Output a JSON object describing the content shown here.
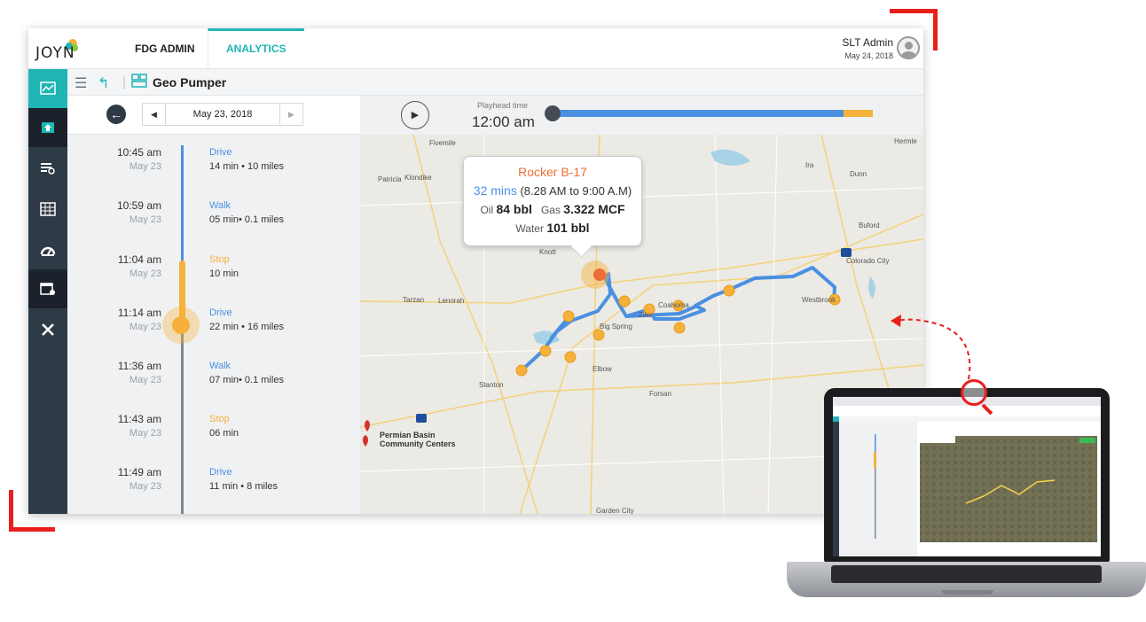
{
  "app": {
    "logo_text": "JOYN",
    "nav": {
      "admin": "FDG ADMIN",
      "analytics": "ANALYTICS"
    },
    "user": {
      "name": "SLT Admin",
      "date": "May 24, 2018"
    }
  },
  "subheader": {
    "title": "Geo Pumper"
  },
  "date_picker": {
    "value": "May 23, 2018",
    "prev": "◀",
    "next": "▶"
  },
  "timeline": [
    {
      "time": "10:45 am",
      "date": "May 23",
      "type": "Drive",
      "detail": "14 min • 10 miles",
      "color": "#4a90e2"
    },
    {
      "time": "10:59 am",
      "date": "May 23",
      "type": "Walk",
      "detail": "05 min• 0.1 miles",
      "color": "#4a90e2"
    },
    {
      "time": "11:04 am",
      "date": "May 23",
      "type": "Stop",
      "detail": "10 min",
      "color": "#f6b13a"
    },
    {
      "time": "11:14 am",
      "date": "May 23",
      "type": "Drive",
      "detail": "22 min • 16 miles",
      "color": "#4a90e2"
    },
    {
      "time": "11:36 am",
      "date": "May 23",
      "type": "Walk",
      "detail": "07 min• 0.1 miles",
      "color": "#4a90e2"
    },
    {
      "time": "11:43 am",
      "date": "May 23",
      "type": "Stop",
      "detail": "06 min",
      "color": "#f6b13a"
    },
    {
      "time": "11:49 am",
      "date": "May 23",
      "type": "Drive",
      "detail": "11 min  • 8 miles",
      "color": "#4a90e2"
    }
  ],
  "player": {
    "label": "Playhead time",
    "time": "12:00 am",
    "progress": 0.9,
    "orange_share": 0.09
  },
  "popup": {
    "title": "Rocker B-17",
    "duration": "32 mins",
    "range": "(8.28 AM to 9:00 A.M)",
    "oil_label": "Oil",
    "oil_value": "84 bbl",
    "gas_label": "Gas",
    "gas_value": "3.322 MCF",
    "water_label": "Water",
    "water_value": "101 bbl"
  },
  "map_labels": {
    "fivemile": "Fivemile",
    "hermleigh": "Hermle",
    "ira": "Ira",
    "dunn": "Dunn",
    "buford": "Buford",
    "colorado_city": "Colorado City",
    "patricia": "Patricia",
    "klondike": "Klondike",
    "knott": "Knott",
    "tarzan": "Tarzan",
    "lenorah": "Lenorah",
    "ziler": "Ziler",
    "big_spring": "Big Spring",
    "elbow": "Elbow",
    "stanton": "Stanton",
    "forsan": "Forsan",
    "garden_city": "Garden City",
    "westbrook": "Westbrook",
    "coahoma": "Coahoma",
    "poi_line1": "Permian Basin",
    "poi_line2": "Community Centers"
  },
  "colors": {
    "accent": "#1fb5b5",
    "route": "#4a90e2",
    "stop": "#f6b13a",
    "highlight": "#ef6c35",
    "marker_red": "#e8201c"
  },
  "icons": [
    "menu-icon",
    "back-arrow-icon",
    "group-icon",
    "chart-icon",
    "home-icon",
    "report-search-icon",
    "table-icon",
    "dashboard-icon",
    "calendar-settings-icon",
    "tools-icon",
    "play-icon",
    "avatar-icon",
    "search-magnifier-icon"
  ]
}
